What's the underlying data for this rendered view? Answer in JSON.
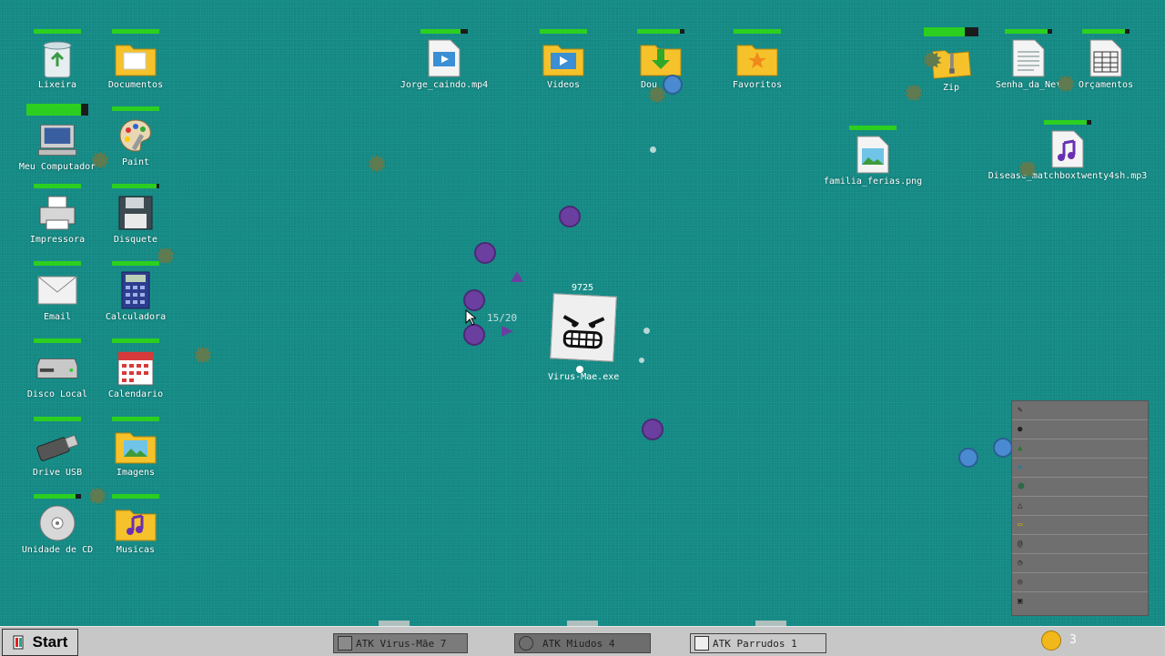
{
  "desktop_icons": [
    {
      "label": "Lixeira",
      "icon": "recycle-bin-icon",
      "hp": 1.0
    },
    {
      "label": "Documentos",
      "icon": "folder-icon",
      "hp": 1.0
    },
    {
      "label": "Meu Computador",
      "icon": "computer-icon",
      "hp": 0.88
    },
    {
      "label": "Paint",
      "icon": "palette-icon",
      "hp": 1.0
    },
    {
      "label": "Impressora",
      "icon": "printer-icon",
      "hp": 1.0
    },
    {
      "label": "Disquete",
      "icon": "floppy-icon",
      "hp": 0.95
    },
    {
      "label": "Email",
      "icon": "envelope-icon",
      "hp": 1.0
    },
    {
      "label": "Calculadora",
      "icon": "calculator-icon",
      "hp": 1.0
    },
    {
      "label": "Disco Local",
      "icon": "hard-drive-icon",
      "hp": 1.0
    },
    {
      "label": "Calendario",
      "icon": "calendar-icon",
      "hp": 1.0
    },
    {
      "label": "Drive USB",
      "icon": "usb-drive-icon",
      "hp": 1.0
    },
    {
      "label": "Imagens",
      "icon": "image-folder-icon",
      "hp": 1.0
    },
    {
      "label": "Unidade de CD",
      "icon": "cd-icon",
      "hp": 0.88
    },
    {
      "label": "Musicas",
      "icon": "music-folder-icon",
      "hp": 1.0
    },
    {
      "label": "Jorge_caindo.mp4",
      "icon": "video-file-icon",
      "hp": 0.85
    },
    {
      "label": "Videos",
      "icon": "video-folder-icon",
      "hp": 1.0
    },
    {
      "label": "Dou",
      "icon": "download-folder-icon",
      "hp": 0.9
    },
    {
      "label": "Favoritos",
      "icon": "star-folder-icon",
      "hp": 1.0
    },
    {
      "label": "Zip",
      "icon": "zip-folder-icon",
      "hp": 0.75
    },
    {
      "label": "Senha_da_Net",
      "icon": "text-file-icon",
      "hp": 0.9
    },
    {
      "label": "Orçamentos",
      "icon": "spreadsheet-icon",
      "hp": 0.9
    },
    {
      "label": "familia_ferias.png",
      "icon": "image-file-icon",
      "hp": 1.0
    },
    {
      "label": "Disease_matchboxtwenty4sh.mp3",
      "icon": "audio-file-icon",
      "hp": 0.9
    }
  ],
  "boss": {
    "name": "Virus-Mae.exe",
    "score": "9725",
    "ammo": "15/20"
  },
  "taskbar": {
    "start_label": "Start",
    "tasks": [
      "ATK Virus-Mãe 7",
      "ATK Miudos 4",
      "ATK Parrudos 1"
    ],
    "coins": "3"
  },
  "colors": {
    "desktop": "#148a85",
    "health": "#2ccf1f",
    "enemy": "#6b3fa0",
    "ally": "#4a8ad0",
    "virus": "#5f7b4f"
  }
}
